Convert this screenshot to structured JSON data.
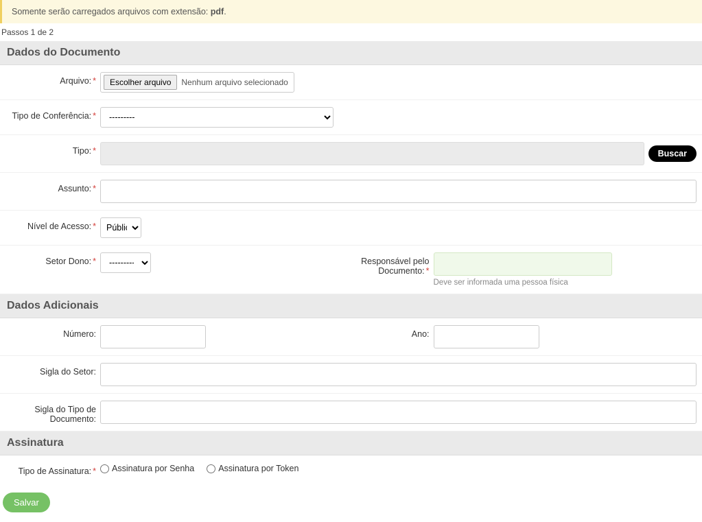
{
  "alert": {
    "text_prefix": "Somente serão carregados arquivos com extensão: ",
    "ext": "pdf",
    "suffix": "."
  },
  "steps": "Passos 1 de 2",
  "sections": {
    "dados_doc": "Dados do Documento",
    "dados_adic": "Dados Adicionais",
    "assinatura": "Assinatura"
  },
  "labels": {
    "arquivo": "Arquivo:",
    "tipo_conf": "Tipo de Conferência:",
    "tipo": "Tipo:",
    "assunto": "Assunto:",
    "nivel": "Nível de Acesso:",
    "setor_dono": "Setor Dono:",
    "responsavel": "Responsável pelo Documento:",
    "numero": "Número:",
    "ano": "Ano:",
    "sigla_setor": "Sigla do Setor:",
    "sigla_tipo": "Sigla do Tipo de Documento:",
    "tipo_assin": "Tipo de Assinatura:"
  },
  "file": {
    "button": "Escolher arquivo",
    "status": "Nenhum arquivo selecionado"
  },
  "options": {
    "tipo_conf_selected": "---------",
    "nivel_selected": "Público",
    "setor_selected": "---------"
  },
  "buttons": {
    "buscar": "Buscar",
    "salvar": "Salvar"
  },
  "help": {
    "responsavel": "Deve ser informada uma pessoa física"
  },
  "radios": {
    "senha": "Assinatura por Senha",
    "token": "Assinatura por Token"
  }
}
